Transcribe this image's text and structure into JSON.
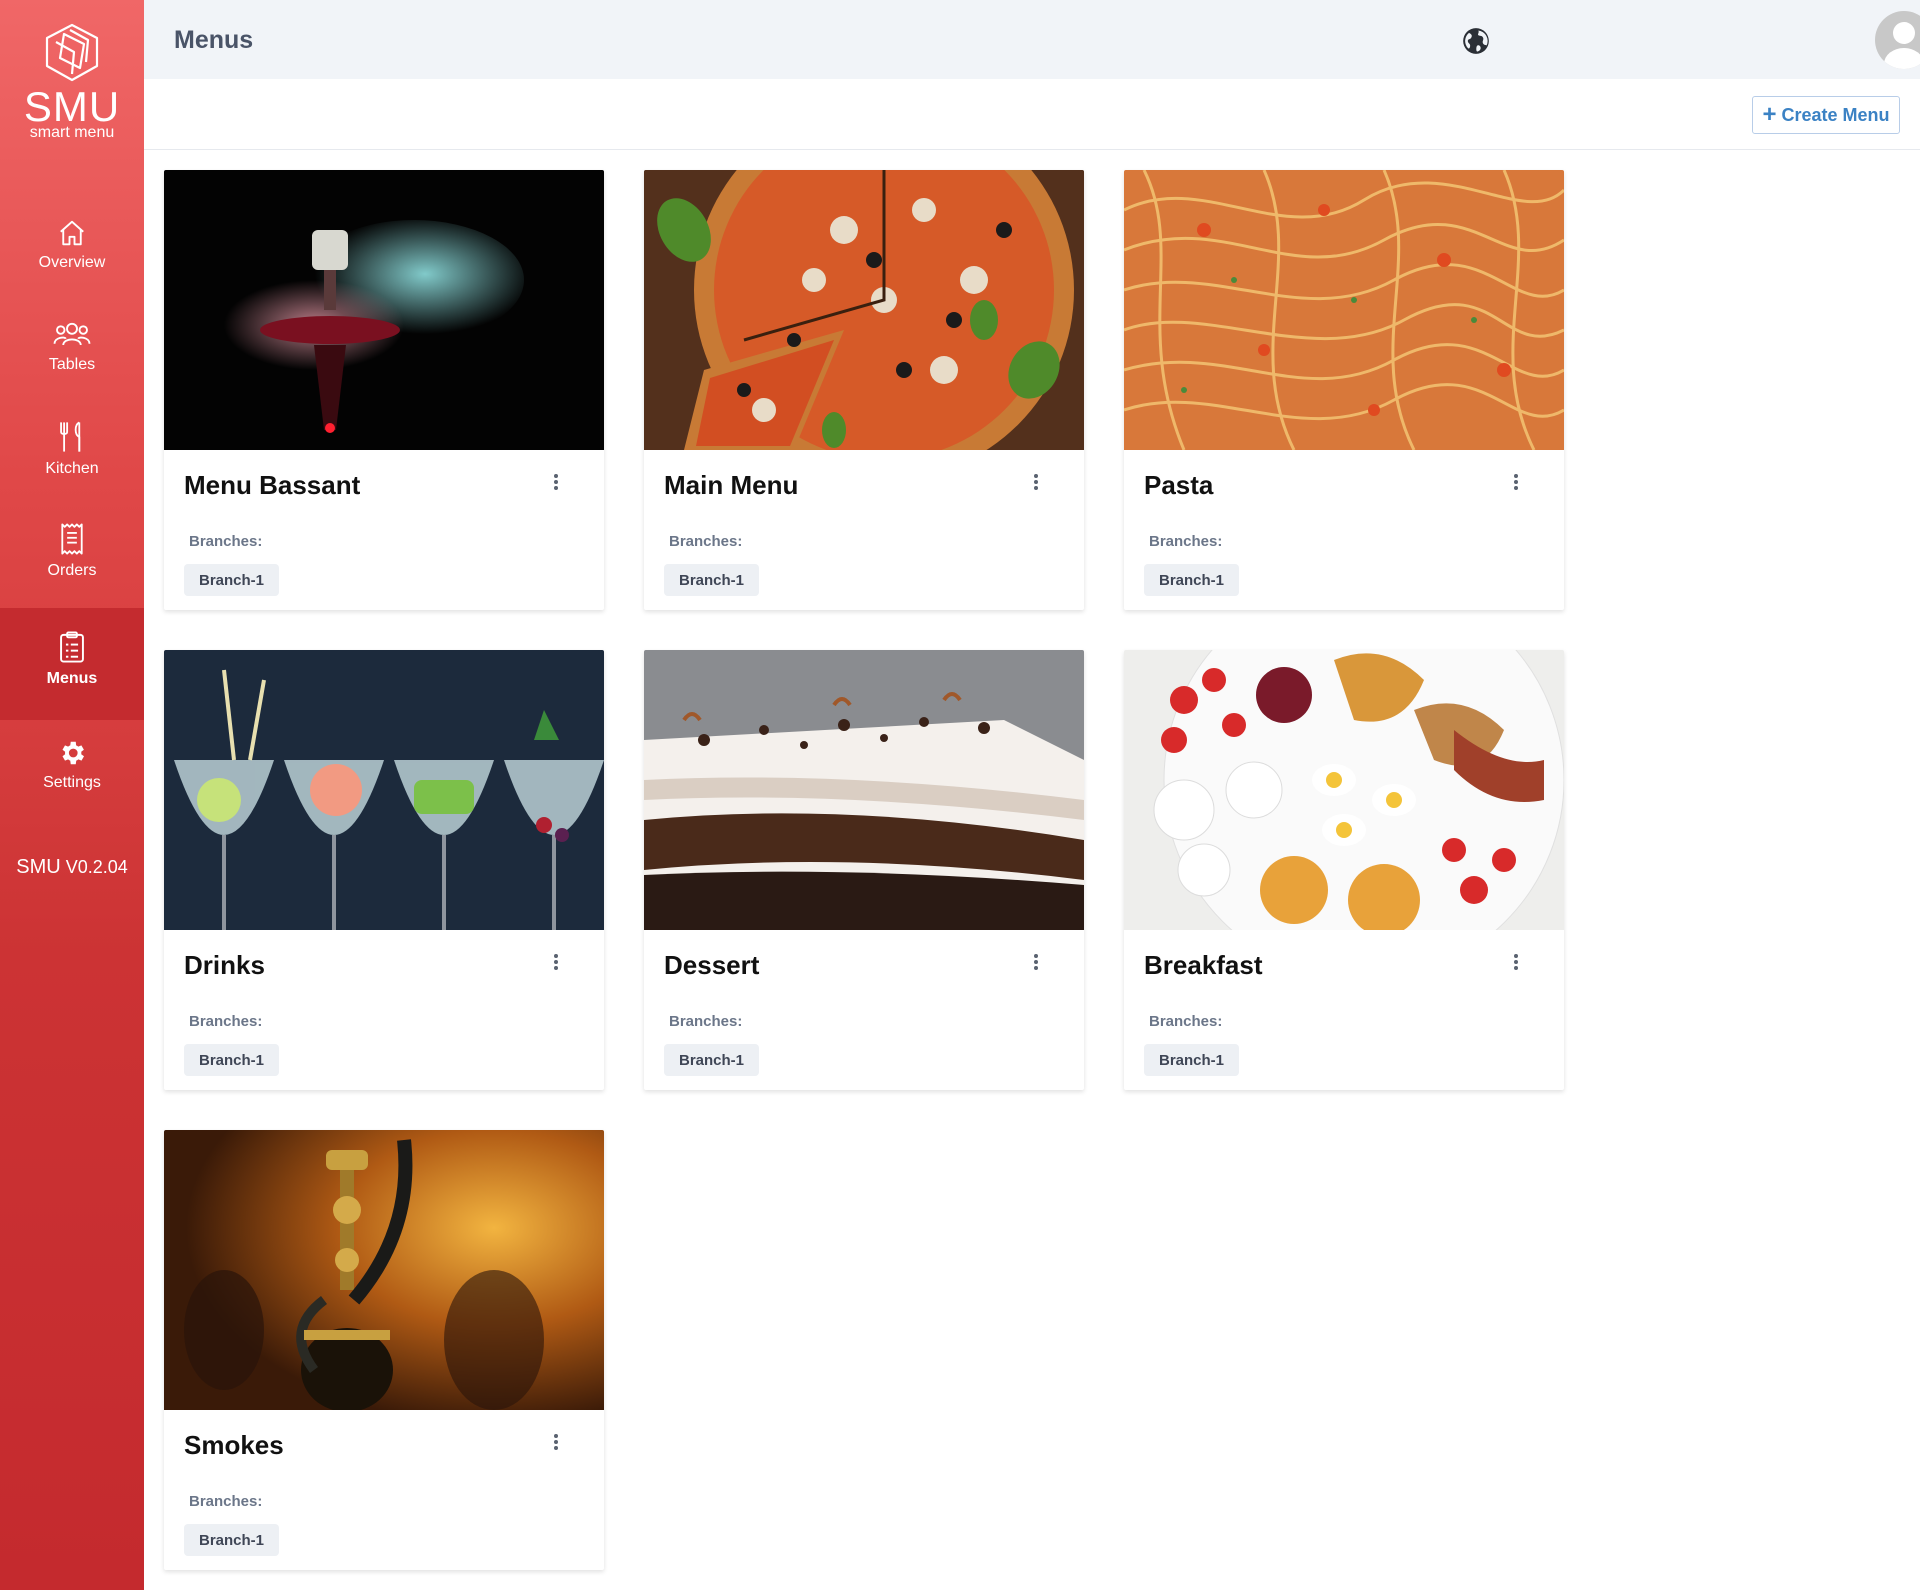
{
  "sidebar": {
    "logo_brand": "SMU",
    "logo_tagline": "smart menu",
    "items": [
      {
        "label": "Overview",
        "icon": "home-icon"
      },
      {
        "label": "Tables",
        "icon": "users-icon"
      },
      {
        "label": "Kitchen",
        "icon": "utensils-icon"
      },
      {
        "label": "Orders",
        "icon": "receipt-icon"
      },
      {
        "label": "Menus",
        "icon": "clipboard-icon",
        "active": true
      },
      {
        "label": "Settings",
        "icon": "gear-icon"
      }
    ],
    "version_brand": "SMU",
    "version_number": "V0.2.04",
    "accent_color": "#e04848"
  },
  "header": {
    "title": "Menus",
    "globe_icon": "globe-icon",
    "avatar_icon": "user-avatar-icon"
  },
  "toolbar": {
    "create_label": "Create Menu",
    "create_color": "#3b82c4"
  },
  "menus": [
    {
      "title": "Menu Bassant",
      "branches_label": "Branches:",
      "branch": "Branch-1",
      "image": "hookah-smoke-image"
    },
    {
      "title": "Main Menu",
      "branches_label": "Branches:",
      "branch": "Branch-1",
      "image": "pizza-image"
    },
    {
      "title": "Pasta",
      "branches_label": "Branches:",
      "branch": "Branch-1",
      "image": "spaghetti-image"
    },
    {
      "title": "Drinks",
      "branches_label": "Branches:",
      "branch": "Branch-1",
      "image": "cocktails-image"
    },
    {
      "title": "Dessert",
      "branches_label": "Branches:",
      "branch": "Branch-1",
      "image": "cake-image"
    },
    {
      "title": "Breakfast",
      "branches_label": "Branches:",
      "branch": "Branch-1",
      "image": "breakfast-platter-image"
    },
    {
      "title": "Smokes",
      "branches_label": "Branches:",
      "branch": "Branch-1",
      "image": "hookah-bar-image"
    }
  ]
}
